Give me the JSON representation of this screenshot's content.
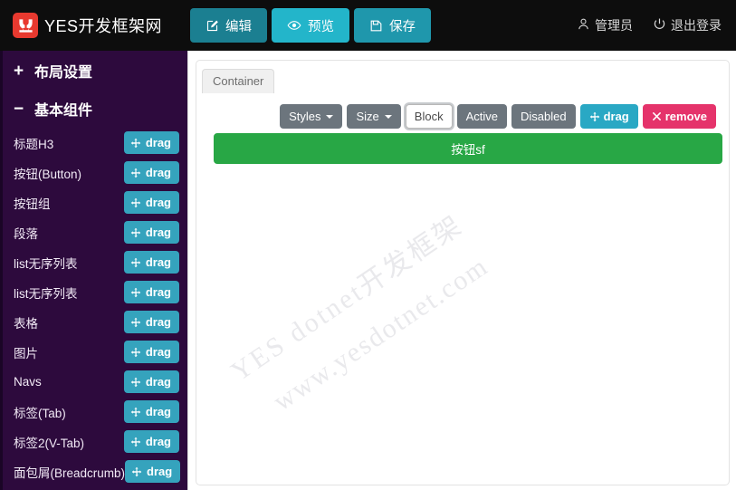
{
  "topnav": {
    "brand": {
      "name": "YES开发框架网",
      "logo_icon": "yes-logo-icon",
      "logo_color": "#e8392f"
    },
    "buttons": [
      {
        "label": "编辑",
        "icon": "edit-pencil-icon",
        "color": "#1b7f91",
        "name": "edit-button"
      },
      {
        "label": "预览",
        "icon": "eye-icon",
        "color": "#23b5ca",
        "name": "preview-button"
      },
      {
        "label": "保存",
        "icon": "save-disk-icon",
        "color": "#1f97ac",
        "name": "save-button"
      }
    ],
    "user": {
      "label": "管理员",
      "icon": "user-icon"
    },
    "logout": {
      "label": "退出登录",
      "icon": "power-icon"
    },
    "background": "#0d0d0d"
  },
  "sidebar": {
    "background": "#2d0a3d",
    "sections": [
      {
        "symbol": "+",
        "title": "布局设置",
        "collapsed": true
      },
      {
        "symbol": "−",
        "title": "基本组件",
        "collapsed": false
      }
    ],
    "drag_label": "drag",
    "drag_icon": "arrows-move-icon",
    "drag_color": "#35a3bd",
    "items": [
      {
        "label": "标题H3"
      },
      {
        "label": "按钮(Button)"
      },
      {
        "label": "按钮组"
      },
      {
        "label": "段落"
      },
      {
        "label": "list无序列表"
      },
      {
        "label": "list无序列表"
      },
      {
        "label": "表格"
      },
      {
        "label": "图片"
      },
      {
        "label": "Navs"
      },
      {
        "label": "标签(Tab)"
      },
      {
        "label": "标签2(V-Tab)"
      },
      {
        "label": "面包屑(Breadcrumb)"
      }
    ]
  },
  "canvas": {
    "container_tab": "Container",
    "toolbar": [
      {
        "label": "Styles",
        "type": "dropdown",
        "state": "normal",
        "name": "styles-dropdown"
      },
      {
        "label": "Size",
        "type": "dropdown",
        "state": "normal",
        "name": "size-dropdown"
      },
      {
        "label": "Block",
        "type": "toggle",
        "state": "active",
        "name": "block-toggle"
      },
      {
        "label": "Active",
        "type": "toggle",
        "state": "normal",
        "name": "active-toggle"
      },
      {
        "label": "Disabled",
        "type": "toggle",
        "state": "normal",
        "name": "disabled-toggle"
      },
      {
        "label": "drag",
        "type": "action",
        "state": "drag",
        "icon": "arrows-move-icon",
        "name": "drag-component-button"
      },
      {
        "label": "remove",
        "type": "action",
        "state": "remove",
        "icon": "close-x-icon",
        "name": "remove-component-button"
      }
    ],
    "selected_component": {
      "label": "按钮sf",
      "style": "success",
      "color": "#28a745",
      "block": true
    },
    "watermark": {
      "line1": "YES  dotnet开发框架",
      "line2": "www.yesdotnet.com",
      "color": "#e9e9ec"
    }
  }
}
